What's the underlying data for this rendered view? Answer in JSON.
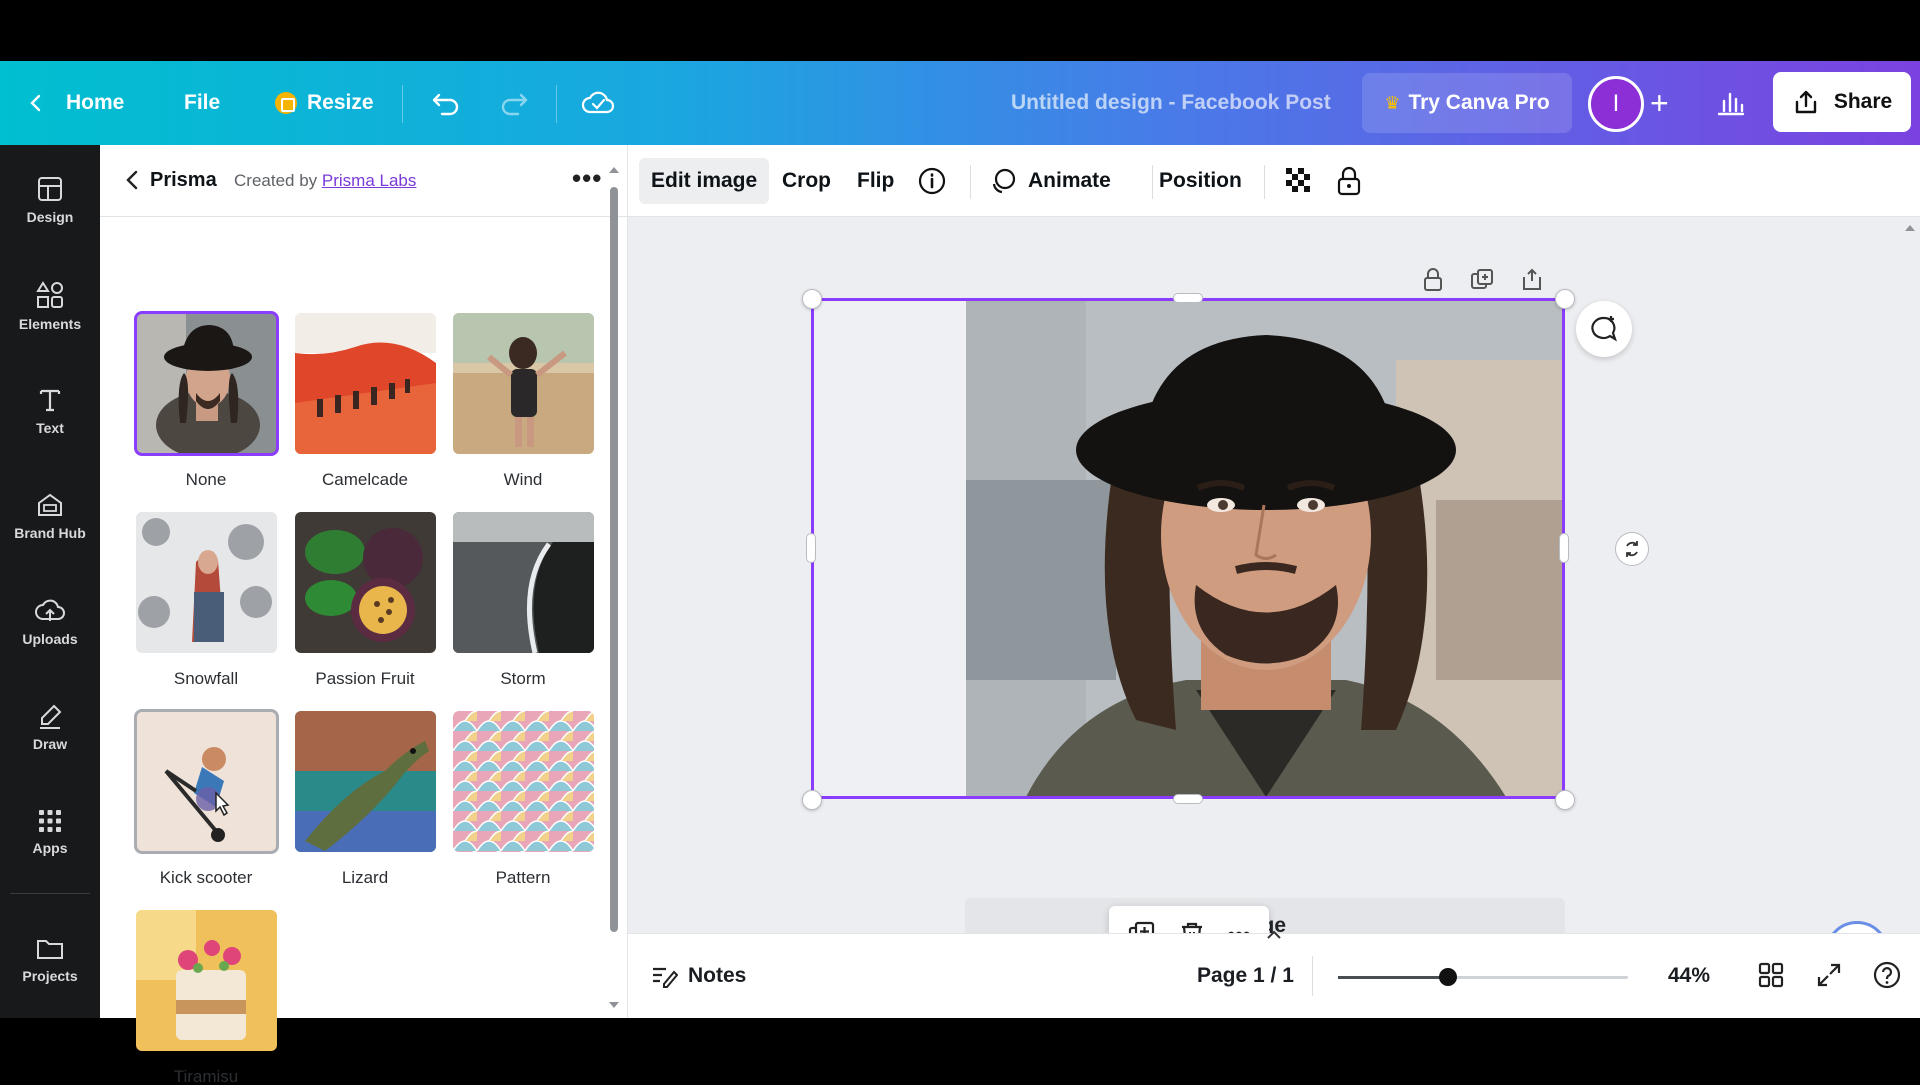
{
  "topbar": {
    "home_label": "Home",
    "file_label": "File",
    "resize_label": "Resize",
    "design_title": "Untitled design - Facebook Post",
    "try_pro_label": "Try Canva Pro",
    "avatar_initial": "I",
    "share_label": "Share"
  },
  "rail": {
    "items": [
      {
        "label": "Design",
        "icon": "layout-icon"
      },
      {
        "label": "Elements",
        "icon": "shapes-icon"
      },
      {
        "label": "Text",
        "icon": "text-icon"
      },
      {
        "label": "Brand Hub",
        "icon": "brand-icon"
      },
      {
        "label": "Uploads",
        "icon": "upload-cloud-icon"
      },
      {
        "label": "Draw",
        "icon": "pen-icon"
      },
      {
        "label": "Apps",
        "icon": "grid-dots-icon"
      },
      {
        "label": "Projects",
        "icon": "folder-icon"
      }
    ]
  },
  "panel": {
    "title": "Prisma",
    "created_by": "Created by",
    "creator": "Prisma Labs",
    "filters": [
      {
        "label": "None",
        "selected": true
      },
      {
        "label": "Camelcade",
        "selected": false
      },
      {
        "label": "Wind",
        "selected": false
      },
      {
        "label": "Snowfall",
        "selected": false
      },
      {
        "label": "Passion Fruit",
        "selected": false
      },
      {
        "label": "Storm",
        "selected": false
      },
      {
        "label": "Kick scooter",
        "selected": false,
        "hovered": true
      },
      {
        "label": "Lizard",
        "selected": false
      },
      {
        "label": "Pattern",
        "selected": false
      },
      {
        "label": "Tiramisu",
        "selected": false
      }
    ]
  },
  "toolbar": {
    "edit_image_label": "Edit image",
    "crop_label": "Crop",
    "flip_label": "Flip",
    "animate_label": "Animate",
    "position_label": "Position"
  },
  "canvas": {
    "add_page_label": "page"
  },
  "bottom": {
    "notes_label": "Notes",
    "page_indicator": "Page 1 / 1",
    "zoom_label": "44%",
    "zoom_fraction": 0.38
  },
  "colors": {
    "accent": "#8b3dff",
    "rail_bg": "#18191b",
    "avatar": "#8c2fd6"
  }
}
